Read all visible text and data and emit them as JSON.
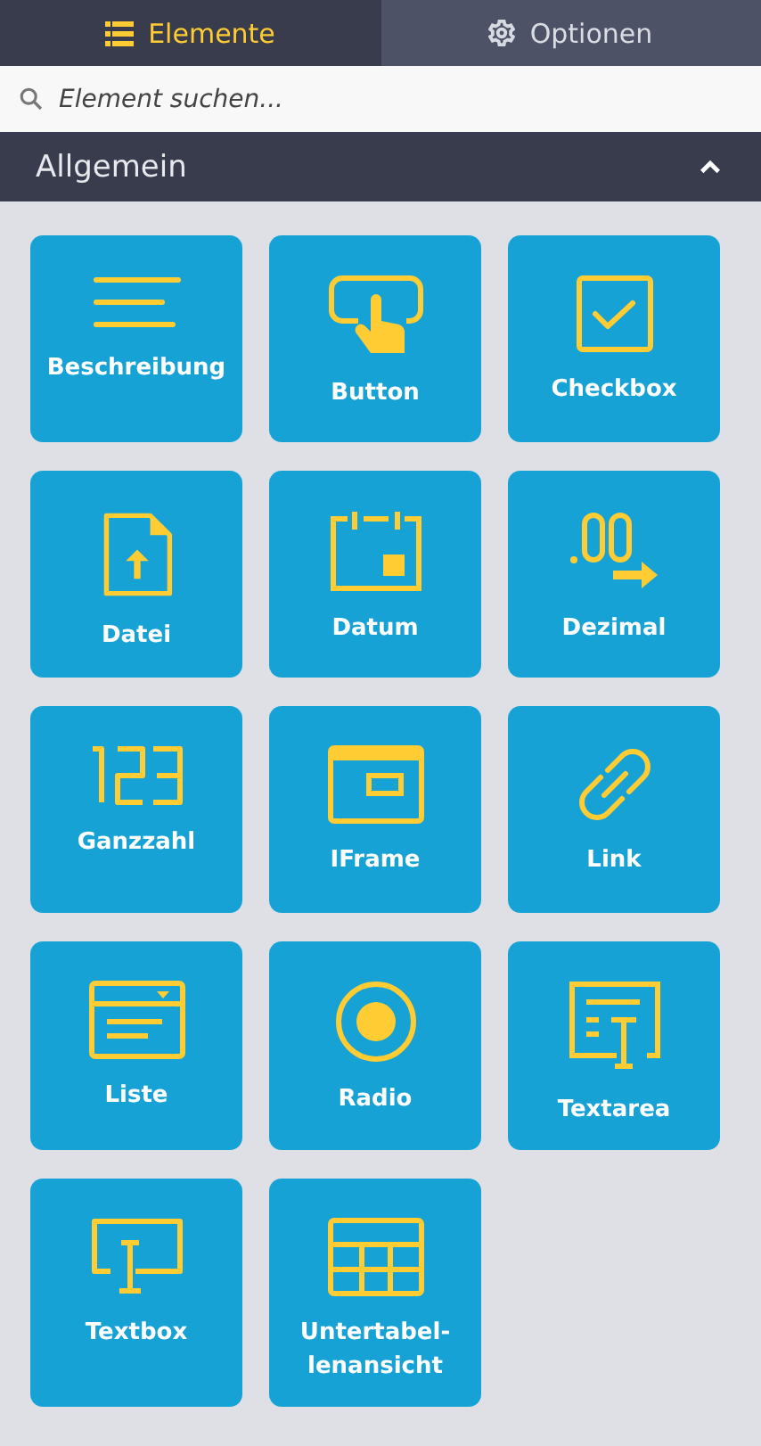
{
  "tabs": [
    {
      "label": "Elemente",
      "kind": "list",
      "selected": true
    },
    {
      "label": "Optionen",
      "kind": "gear",
      "selected": false
    }
  ],
  "search": {
    "placeholder": "Element suchen..."
  },
  "section": {
    "title": "Allgemein",
    "expanded": true,
    "items": [
      {
        "label": "Beschreibung",
        "kind": "lines"
      },
      {
        "label": "Button",
        "kind": "button"
      },
      {
        "label": "Checkbox",
        "kind": "checkbox"
      },
      {
        "label": "Datei",
        "kind": "file"
      },
      {
        "label": "Datum",
        "kind": "date"
      },
      {
        "label": "Dezimal",
        "kind": "decimal"
      },
      {
        "label": "Ganzzahl",
        "kind": "integer"
      },
      {
        "label": "IFrame",
        "kind": "iframe"
      },
      {
        "label": "Link",
        "kind": "link"
      },
      {
        "label": "Liste",
        "kind": "list"
      },
      {
        "label": "Radio",
        "kind": "radio"
      },
      {
        "label": "Textarea",
        "kind": "textarea"
      },
      {
        "label": "Textbox",
        "kind": "textbox"
      },
      {
        "label": "Untertabel-\nlenansicht",
        "kind": "table"
      }
    ]
  }
}
